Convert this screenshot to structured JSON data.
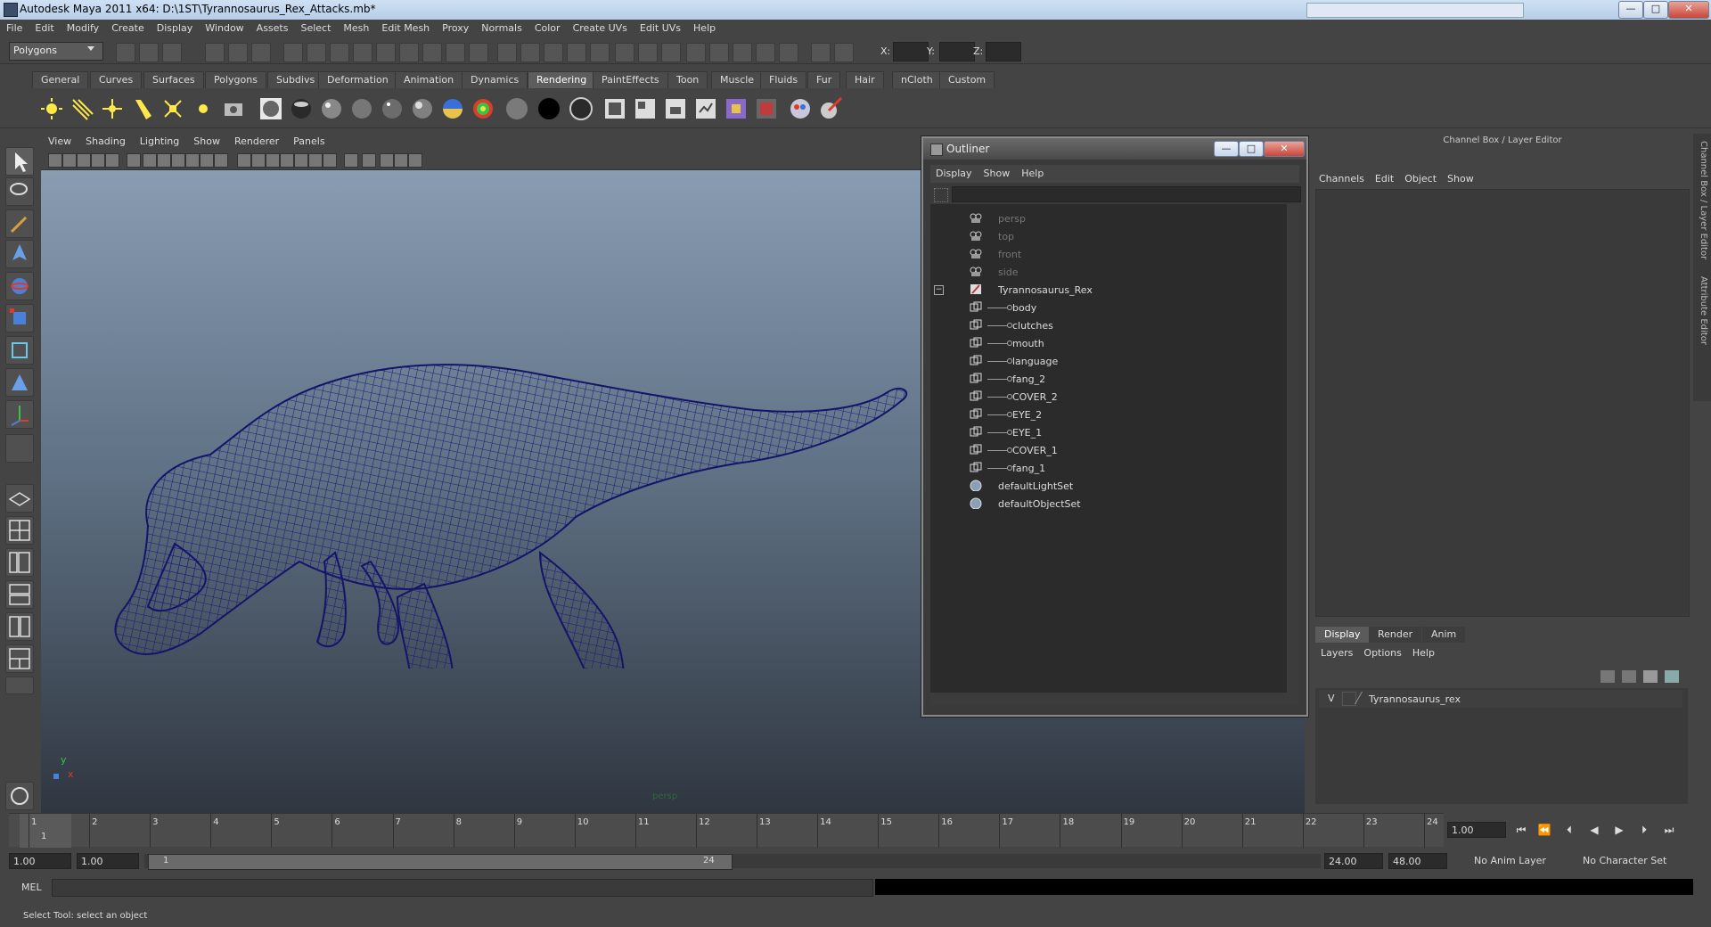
{
  "window": {
    "title": "Autodesk Maya 2011 x64: D:\\1ST\\Tyrannosaurus_Rex_Attacks.mb*",
    "min": "—",
    "max": "□",
    "close": "✕"
  },
  "menubar": [
    "File",
    "Edit",
    "Modify",
    "Create",
    "Display",
    "Window",
    "Assets",
    "Select",
    "Mesh",
    "Edit Mesh",
    "Proxy",
    "Normals",
    "Color",
    "Create UVs",
    "Edit UVs",
    "Help"
  ],
  "status": {
    "mode": "Polygons",
    "x_label": "X:",
    "y_label": "Y:",
    "z_label": "Z:"
  },
  "shelf_tabs": [
    "General",
    "Curves",
    "Surfaces",
    "Polygons",
    "Subdivs",
    "Deformation",
    "Animation",
    "Dynamics",
    "Rendering",
    "PaintEffects",
    "Toon",
    "Muscle",
    "Fluids",
    "Fur",
    "Hair",
    "nCloth",
    "Custom"
  ],
  "shelf_active": "Rendering",
  "viewport": {
    "menu": [
      "View",
      "Shading",
      "Lighting",
      "Show",
      "Renderer",
      "Panels"
    ],
    "camera_label": "persp",
    "axis_y": "y",
    "axis_x": "x"
  },
  "outliner": {
    "title": "Outliner",
    "menu": [
      "Display",
      "Show",
      "Help"
    ],
    "items": [
      {
        "label": "persp",
        "dim": true
      },
      {
        "label": "top",
        "dim": true
      },
      {
        "label": "front",
        "dim": true
      },
      {
        "label": "side",
        "dim": true
      },
      {
        "label": "Tyrannosaurus_Rex",
        "dim": false,
        "expanded": true
      },
      {
        "label": "body",
        "child": true
      },
      {
        "label": "clutches",
        "child": true
      },
      {
        "label": "mouth",
        "child": true
      },
      {
        "label": "language",
        "child": true
      },
      {
        "label": "fang_2",
        "child": true
      },
      {
        "label": "COVER_2",
        "child": true
      },
      {
        "label": "EYE_2",
        "child": true
      },
      {
        "label": "EYE_1",
        "child": true
      },
      {
        "label": "COVER_1",
        "child": true
      },
      {
        "label": "fang_1",
        "child": true
      },
      {
        "label": "defaultLightSet",
        "set": true
      },
      {
        "label": "defaultObjectSet",
        "set": true
      }
    ]
  },
  "channelbox": {
    "header": "Channel Box / Layer Editor",
    "menu": [
      "Channels",
      "Edit",
      "Object",
      "Show"
    ],
    "layer_tabs": [
      "Display",
      "Render",
      "Anim"
    ],
    "layer_tab_active": "Display",
    "layer_menu": [
      "Layers",
      "Options",
      "Help"
    ],
    "layer": {
      "visibility": "V",
      "name": "Tyrannosaurus_rex"
    },
    "side_tabs": [
      "Channel Box / Layer Editor",
      "Attribute Editor"
    ]
  },
  "timeline": {
    "ticks": [
      "1",
      "2",
      "3",
      "4",
      "5",
      "6",
      "7",
      "8",
      "9",
      "10",
      "11",
      "12",
      "13",
      "14",
      "15",
      "16",
      "17",
      "18",
      "19",
      "20",
      "21",
      "22",
      "23",
      "24"
    ],
    "current_frame_label": "1",
    "current_frame_field": "1.00"
  },
  "range": {
    "start_time": "1.00",
    "playback_start": "1.00",
    "slider_start": "1",
    "slider_end": "24",
    "playback_end": "24.00",
    "end_time": "48.00",
    "anim_layer": "No Anim Layer",
    "character_set": "No Character Set"
  },
  "cmdline": {
    "label": "MEL"
  },
  "helpline": {
    "text": "Select Tool: select an object"
  }
}
